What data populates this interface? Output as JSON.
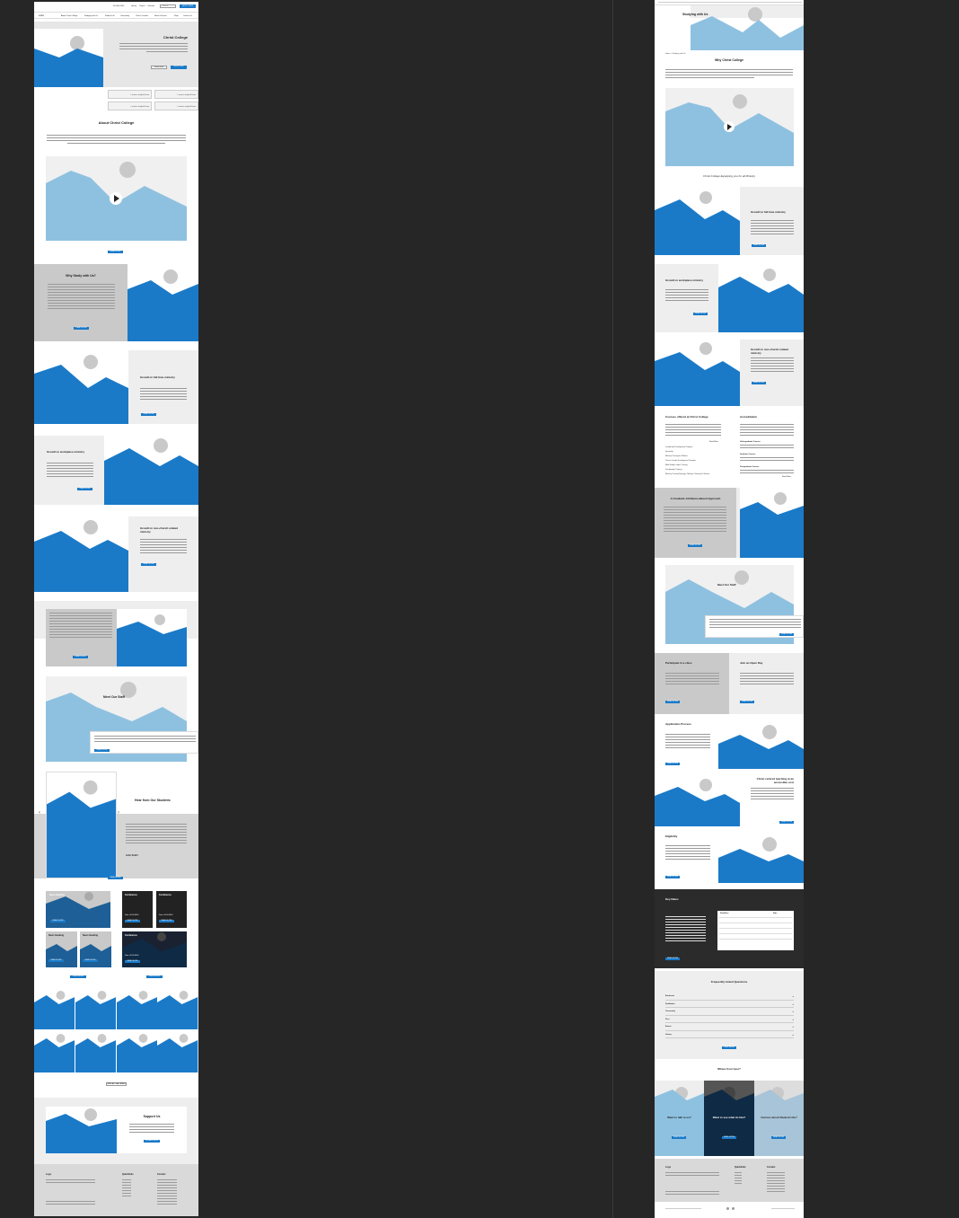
{
  "left": {
    "topbar": {
      "links": [
        "Library",
        "Chapel",
        "Calendar"
      ],
      "phone": "00 0000 0000",
      "search": "search",
      "cta": "APPLY NOW"
    },
    "nav": [
      "About Christ College",
      "Studying with Us",
      "Student Life",
      "Community",
      "Church Leaders",
      "News & Events",
      "Shop",
      "Contact Us"
    ],
    "logo": "LOGO",
    "hero": {
      "title": "Christ College",
      "btn1": "Learn more",
      "btn2": "Get In Touch"
    },
    "study_tiles": [
      "I want to study full time",
      "I want to study full time",
      "I want to study full time",
      "I want to study full time"
    ],
    "about": {
      "title": "About Christ College",
      "btn": "READ MORE"
    },
    "why": {
      "title": "Why Study with Us?",
      "btn": "READ MORE"
    },
    "growth": [
      {
        "title": "Growth in full time ministry",
        "btn": "READ MORE"
      },
      {
        "title": "Growth in workplace ministry",
        "btn": "READ MORE"
      },
      {
        "title": "Growth in non-church related ministry",
        "btn": "READ MORE"
      }
    ],
    "block_btn": "READ MORE",
    "staff": {
      "title": "Meet Our Staff",
      "btn": "READ MORE"
    },
    "students": {
      "title": "Hear from Our Students",
      "name": "John Smith",
      "btn": "READ MORE"
    },
    "news": [
      {
        "title": "News Heading",
        "btn": "READ MORE"
      },
      {
        "title": "News Heading",
        "btn": "READ MORE"
      },
      {
        "title": "News Heading",
        "btn": "READ MORE"
      }
    ],
    "conferences": [
      {
        "title": "Conference",
        "date": "Date: 00.00.0000",
        "btn": "READ MORE"
      },
      {
        "title": "Conference",
        "date": "Date: 00.00.0000",
        "btn": "READ MORE"
      },
      {
        "title": "Conference",
        "date": "Date: 00.00.0000",
        "btn": "READ MORE"
      }
    ],
    "news_btn": "VIEW MORE",
    "events_btn": "VIEW MORE",
    "gallery_btn": "VIEW ALL GALLERIES",
    "support": {
      "title": "Support Us",
      "btn": "DONATE NOW"
    },
    "footer": {
      "logo": "Logo",
      "col2": "Quicklinks",
      "col3": "Contact"
    }
  },
  "right": {
    "hero_title": "Studying with Us",
    "breadcrumb": "Home  >  Studying with Us",
    "why_title": "Why Christ College",
    "video_caption": "Christ College Equipping you for all Ministry",
    "growth": [
      {
        "title": "Growth in full time ministry",
        "btn": "READ MORE"
      },
      {
        "title": "Growth in workplace ministry",
        "btn": "READ MORE"
      },
      {
        "title": "Growth in non-church related ministry",
        "btn": "READ MORE"
      }
    ],
    "courses": {
      "title": "Courses offered at Christ College",
      "items": [
        "Leadership Development Program",
        "Internship",
        "Ministry Training for Women",
        "Church Leader Development Program",
        "Bible Study Leader Training",
        "Discipleship Training",
        "Ministry Training Strategy - Ministry Training for Women"
      ],
      "more": "Read More"
    },
    "accreditation": {
      "title": "Accreditation",
      "items": [
        "Undergraduate Courses",
        "Graduate Courses",
        "Postgraduate Courses"
      ],
      "more": "Read More"
    },
    "graduate": {
      "title": "A Graduate Attributes-Based Approach",
      "btn": "READ MORE"
    },
    "staff": {
      "title": "Meet Our Staff",
      "btn": "READ MORE"
    },
    "participate": {
      "title": "Participate in a class",
      "btn": "READ MORE"
    },
    "openday": {
      "title": "Join an Open Day",
      "btn": "READ MORE"
    },
    "application": {
      "title": "Application Process",
      "btn": "READ MORE"
    },
    "teaching": {
      "title": "Christ centred teaching at an accessible cost",
      "btn": "READ MORE"
    },
    "eligibility": {
      "title": "Eligibility",
      "btn": "READ MORE"
    },
    "keydates": {
      "title": "Key Dates",
      "col1": "Deadlines",
      "col2": "Date",
      "btn": "READ MORE"
    },
    "faq": {
      "title": "Frequently Asked Questions",
      "items": [
        "Enrolment",
        "Facilitation",
        "Community",
        "Fees",
        "Events",
        "Library"
      ],
      "btn": "VIEW MORE"
    },
    "where": {
      "title": "Where from here?",
      "cards": [
        {
          "title": "Want to talk to us?",
          "btn": "READ MORE"
        },
        {
          "title": "Want to see what its like?",
          "btn": "READ MORE"
        },
        {
          "title": "Curious about Student Life?",
          "btn": "READ MORE"
        }
      ]
    },
    "footer": {
      "logo": "Logo",
      "col2": "Quicklinks",
      "col3": "Contact"
    }
  }
}
